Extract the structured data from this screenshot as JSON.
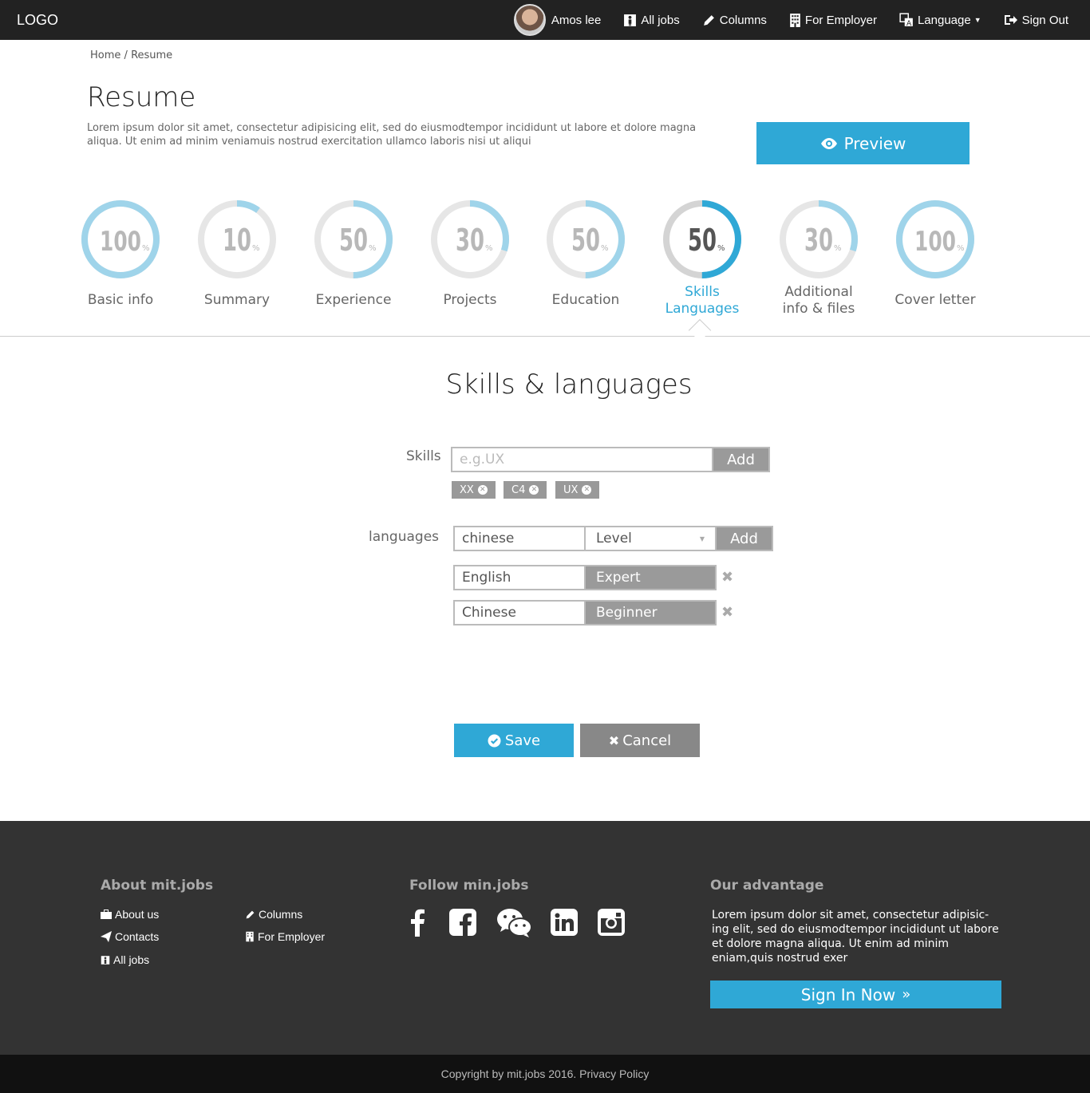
{
  "header": {
    "logo": "LOGO",
    "user_name": "Amos lee",
    "nav": [
      {
        "label": "All jobs",
        "icon": "male-icon"
      },
      {
        "label": "Columns",
        "icon": "pencil-icon"
      },
      {
        "label": "For Employer",
        "icon": "building-icon"
      },
      {
        "label": "Language",
        "icon": "translate-icon"
      },
      {
        "label": "Sign Out",
        "icon": "sign-out-icon"
      }
    ]
  },
  "breadcrumb": {
    "home": "Home",
    "sep": "/",
    "current": "Resume"
  },
  "page": {
    "title": "Resume",
    "intro": "Lorem ipsum dolor sit amet, consectetur adipisicing elit, sed do eiusmodtempor incididunt ut labore et dolore magna aliqua. Ut enim ad minim veniamuis nostrud exercitation ullamco laboris nisi ut aliqui",
    "preview_label": "Preview"
  },
  "progress_steps": [
    {
      "value": 100,
      "unit": "%",
      "label": "Basic info",
      "label2": ""
    },
    {
      "value": 10,
      "unit": "%",
      "label": "Summary",
      "label2": ""
    },
    {
      "value": 50,
      "unit": "%",
      "label": "Experience",
      "label2": ""
    },
    {
      "value": 30,
      "unit": "%",
      "label": "Projects",
      "label2": ""
    },
    {
      "value": 50,
      "unit": "%",
      "label": "Education",
      "label2": ""
    },
    {
      "value": 50,
      "unit": "%",
      "label": "Skills",
      "label2": "Languages",
      "active": true
    },
    {
      "value": 30,
      "unit": "%",
      "label": "Additional",
      "label2": "info & files"
    },
    {
      "value": 100,
      "unit": "%",
      "label": "Cover letter",
      "label2": ""
    }
  ],
  "section": {
    "title": "Skills & languages",
    "skills_label": "Skills",
    "skills_placeholder": "e.g.UX",
    "skills_add": "Add",
    "skills": [
      "XX",
      "C4",
      "UX"
    ],
    "languages_label": "languages",
    "language_input_value": "chinese",
    "level_select": "Level",
    "languages_add": "Add",
    "languages": [
      {
        "name": "English",
        "level": "Expert"
      },
      {
        "name": "Chinese",
        "level": "Beginner"
      }
    ],
    "save_label": "Save",
    "cancel_label": "Cancel"
  },
  "footer": {
    "about_title": "About mit.jobs",
    "about_links": [
      {
        "label": "About us",
        "icon": "briefcase-icon"
      },
      {
        "label": "Contacts",
        "icon": "paper-plane-icon"
      },
      {
        "label": "All jobs",
        "icon": "male-icon"
      },
      {
        "label": "Columns",
        "icon": "pencil-icon"
      },
      {
        "label": "For Employer",
        "icon": "building-icon"
      }
    ],
    "follow_title": "Follow min.jobs",
    "social": [
      "facebook-icon",
      "facebook-square-icon",
      "wechat-icon",
      "linkedin-icon",
      "instagram-icon"
    ],
    "advantage_title": "Our advantage",
    "advantage_text": "Lorem ipsum dolor sit amet, consectetur adipisic-ing elit, sed do eiusmodtempor incididunt ut labore et dolore magna aliqua. Ut enim ad minim eniam,quis nostrud exer",
    "signin_label": "Sign In Now",
    "copyright": "Copyright by mit.jobs 2016. Privacy Policy"
  },
  "colors": {
    "accent": "#2fa8d6",
    "ring_light": "#9fd4ea",
    "ring_track": "#e6e6e6",
    "dark": "#222222",
    "footer": "#333333"
  }
}
